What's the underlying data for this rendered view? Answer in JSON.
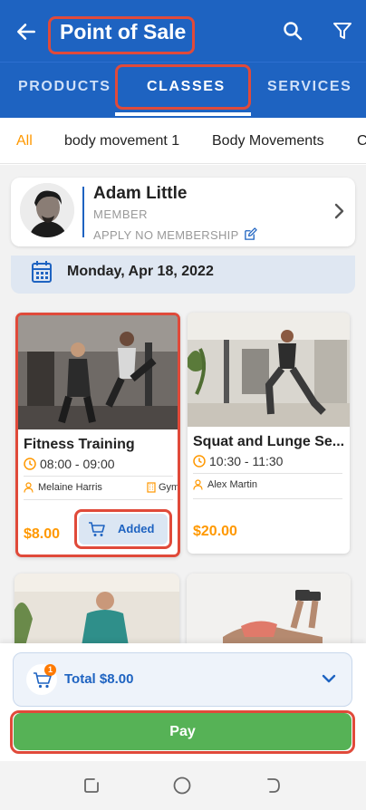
{
  "header": {
    "title": "Point of Sale",
    "back_icon": "arrow-left-icon",
    "search_icon": "search-icon",
    "filter_icon": "filter-icon"
  },
  "tabs": [
    {
      "label": "PRODUCTS",
      "active": false
    },
    {
      "label": "CLASSES",
      "active": true
    },
    {
      "label": "SERVICES",
      "active": false
    }
  ],
  "categories": [
    {
      "label": "All",
      "active": true
    },
    {
      "label": "body movement 1",
      "active": false
    },
    {
      "label": "Body Movements",
      "active": false
    },
    {
      "label": "C",
      "active": false
    }
  ],
  "member": {
    "name": "Adam Little",
    "role": "MEMBER",
    "apply_label": "APPLY NO MEMBERSHIP"
  },
  "date": {
    "label": "Monday, Apr 18, 2022"
  },
  "classes": [
    {
      "name": "Fitness Training",
      "time": "08:00 - 09:00",
      "trainer": "Melaine Harris",
      "location": "Gym",
      "price": "$8.00",
      "button_label": "Added"
    },
    {
      "name": "Squat and Lunge Se...",
      "time": "10:30 - 11:30",
      "trainer": "Alex Martin",
      "price": "$20.00"
    }
  ],
  "cart": {
    "count": "1",
    "total_label": "Total $8.00"
  },
  "pay_label": "Pay",
  "colors": {
    "primary": "#1e63c1",
    "accent_orange": "#ff9800",
    "pay_green": "#56b256",
    "highlight_red": "#e04a3a"
  }
}
